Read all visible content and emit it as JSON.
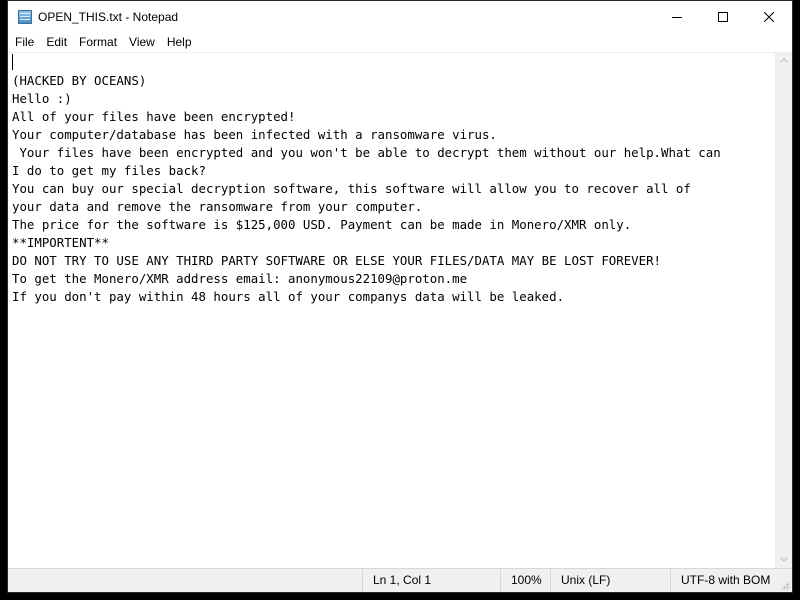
{
  "window": {
    "title": "OPEN_THIS.txt - Notepad",
    "app_icon": "notepad-icon",
    "controls": {
      "minimize": "minimize-icon",
      "maximize": "maximize-icon",
      "close": "close-icon"
    }
  },
  "menu": {
    "items": [
      {
        "label": "File"
      },
      {
        "label": "Edit"
      },
      {
        "label": "Format"
      },
      {
        "label": "View"
      },
      {
        "label": "Help"
      }
    ]
  },
  "editor": {
    "lines": [
      "",
      "(HACKED BY OCEANS)",
      "Hello :)",
      "All of your files have been encrypted!",
      "Your computer/database has been infected with a ransomware virus.",
      " Your files have been encrypted and you won't be able to decrypt them without our help.What can",
      "I do to get my files back?",
      "You can buy our special decryption software, this software will allow you to recover all of",
      "your data and remove the ransomware from your computer.",
      "The price for the software is $125,000 USD. Payment can be made in Monero/XMR only.",
      "**IMPORTENT**",
      "DO NOT TRY TO USE ANY THIRD PARTY SOFTWARE OR ELSE YOUR FILES/DATA MAY BE LOST FOREVER!",
      "To get the Monero/XMR address email: anonymous22109@proton.me",
      "If you don't pay within 48 hours all of your companys data will be leaked."
    ]
  },
  "statusbar": {
    "position": "Ln 1, Col 1",
    "zoom": "100%",
    "line_ending": "Unix (LF)",
    "encoding": "UTF-8 with BOM"
  }
}
